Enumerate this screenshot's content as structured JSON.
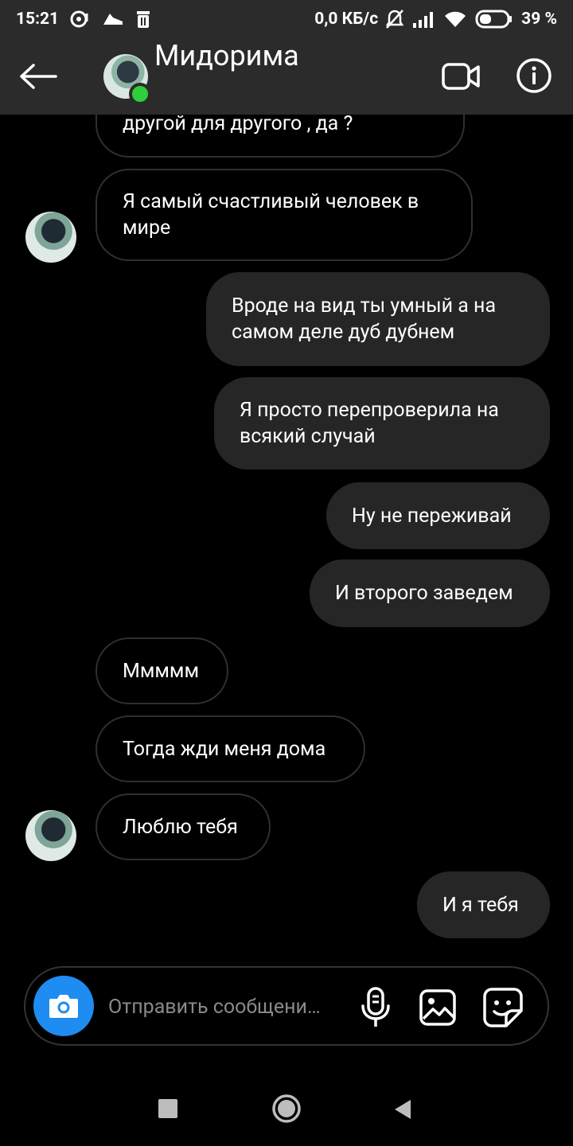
{
  "status_bar": {
    "time": "15:21",
    "network_speed": "0,0 КБ/с",
    "battery": "39 %",
    "icons": [
      "disc-icon",
      "running-shoe-icon",
      "trash-icon",
      "bell-off-icon",
      "signal-icon",
      "wifi-icon",
      "battery-icon"
    ]
  },
  "header": {
    "contact_name": "Мидорима",
    "online": true,
    "accent_online": "#2fcf3b"
  },
  "messages": [
    {
      "direction": "in",
      "text": "другой для другого , да ?"
    },
    {
      "direction": "in",
      "text": "Я самый счастливый человек в мире"
    },
    {
      "direction": "out",
      "text": "Вроде на вид ты умный а на самом деле дуб дубнем"
    },
    {
      "direction": "out",
      "text": "Я просто перепроверила на всякий случай"
    },
    {
      "direction": "out",
      "text": "Ну не переживай"
    },
    {
      "direction": "out",
      "text": "И второго заведем"
    },
    {
      "direction": "in",
      "text": "Ммммм"
    },
    {
      "direction": "in",
      "text": "Тогда жди меня дома"
    },
    {
      "direction": "in",
      "text": "Люблю тебя"
    },
    {
      "direction": "out",
      "text": "И я тебя"
    }
  ],
  "composer": {
    "placeholder": "Отправить сообщени…",
    "accent": "#1e8cf0"
  }
}
